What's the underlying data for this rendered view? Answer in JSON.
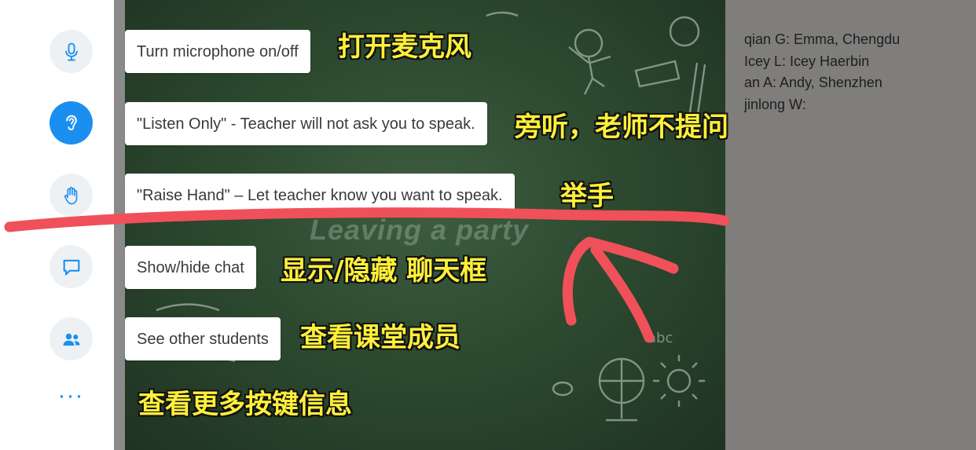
{
  "sidebar": {
    "buttons": [
      {
        "icon": "microphone-icon"
      },
      {
        "icon": "ear-icon"
      },
      {
        "icon": "raise-hand-icon"
      },
      {
        "icon": "chat-icon"
      },
      {
        "icon": "people-icon"
      }
    ],
    "more_label": "···"
  },
  "callouts": {
    "microphone": "Turn microphone on/off",
    "listen_only": "\"Listen Only\" - Teacher will not ask you to speak.",
    "raise_hand": "\"Raise Hand\" – Let teacher know you want to speak.",
    "chat": "Show/hide chat",
    "students": "See other students"
  },
  "notes": {
    "microphone": "打开麦克风",
    "listen_only": "旁听，老师不提问",
    "raise_hand": "举手",
    "chat": "显示/隐藏 聊天框",
    "students": "查看课堂成员",
    "more": "查看更多按键信息"
  },
  "stage": {
    "title": "Leaving a party",
    "chalk_text": "abc"
  },
  "students": [
    "qian G: Emma, Chengdu",
    "Icey L: Icey Haerbin",
    "an A: Andy, Shenzhen",
    "jinlong W:"
  ],
  "colors": {
    "accent": "#1a8ff0",
    "annotation": "#f0505a",
    "note_text": "#fff03a"
  }
}
